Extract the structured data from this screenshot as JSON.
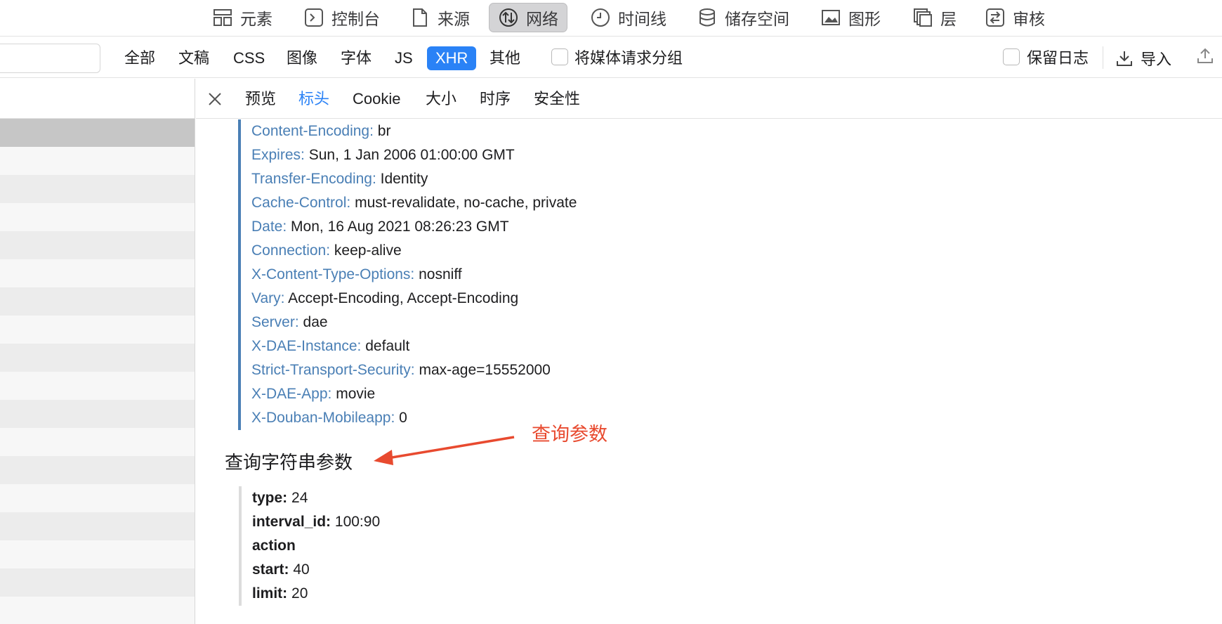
{
  "toolbar": {
    "tabs": [
      {
        "label": "元素",
        "icon": "elements-icon"
      },
      {
        "label": "控制台",
        "icon": "console-icon"
      },
      {
        "label": "来源",
        "icon": "sources-icon"
      },
      {
        "label": "网络",
        "icon": "network-icon",
        "active": true
      },
      {
        "label": "时间线",
        "icon": "timeline-icon"
      },
      {
        "label": "储存空间",
        "icon": "storage-icon"
      },
      {
        "label": "图形",
        "icon": "graphics-icon"
      },
      {
        "label": "层",
        "icon": "layers-icon"
      },
      {
        "label": "审核",
        "icon": "audit-icon"
      }
    ]
  },
  "filters": {
    "types": [
      "全部",
      "文稿",
      "CSS",
      "图像",
      "字体",
      "JS",
      "XHR",
      "其他"
    ],
    "selected": "XHR",
    "group_media_label": "将媒体请求分组",
    "preserve_log_label": "保留日志",
    "import_label": "导入"
  },
  "detail_tabs": {
    "tabs": [
      "预览",
      "标头",
      "Cookie",
      "大小",
      "时序",
      "安全性"
    ],
    "active": "标头"
  },
  "response_headers": [
    {
      "key": "Content-Encoding:",
      "value": "br"
    },
    {
      "key": "Expires:",
      "value": "Sun, 1 Jan 2006 01:00:00 GMT"
    },
    {
      "key": "Transfer-Encoding:",
      "value": "Identity"
    },
    {
      "key": "Cache-Control:",
      "value": "must-revalidate, no-cache, private"
    },
    {
      "key": "Date:",
      "value": "Mon, 16 Aug 2021 08:26:23 GMT"
    },
    {
      "key": "Connection:",
      "value": "keep-alive"
    },
    {
      "key": "X-Content-Type-Options:",
      "value": "nosniff"
    },
    {
      "key": "Vary:",
      "value": "Accept-Encoding, Accept-Encoding"
    },
    {
      "key": "Server:",
      "value": "dae"
    },
    {
      "key": "X-DAE-Instance:",
      "value": "default"
    },
    {
      "key": "Strict-Transport-Security:",
      "value": "max-age=15552000"
    },
    {
      "key": "X-DAE-App:",
      "value": "movie"
    },
    {
      "key": "X-Douban-Mobileapp:",
      "value": "0"
    }
  ],
  "query_section": {
    "title": "查询字符串参数",
    "params": [
      {
        "key": "type:",
        "value": "24"
      },
      {
        "key": "interval_id:",
        "value": "100:90"
      },
      {
        "key": "action",
        "value": ""
      },
      {
        "key": "start:",
        "value": "40"
      },
      {
        "key": "limit:",
        "value": "20"
      }
    ]
  },
  "annotation": {
    "text": "查询参数",
    "color": "#e84a2f"
  },
  "colors": {
    "accent": "#2a82f6",
    "header_key": "#4a7fb5",
    "toolbar_active_bg": "#d4d4d6"
  }
}
